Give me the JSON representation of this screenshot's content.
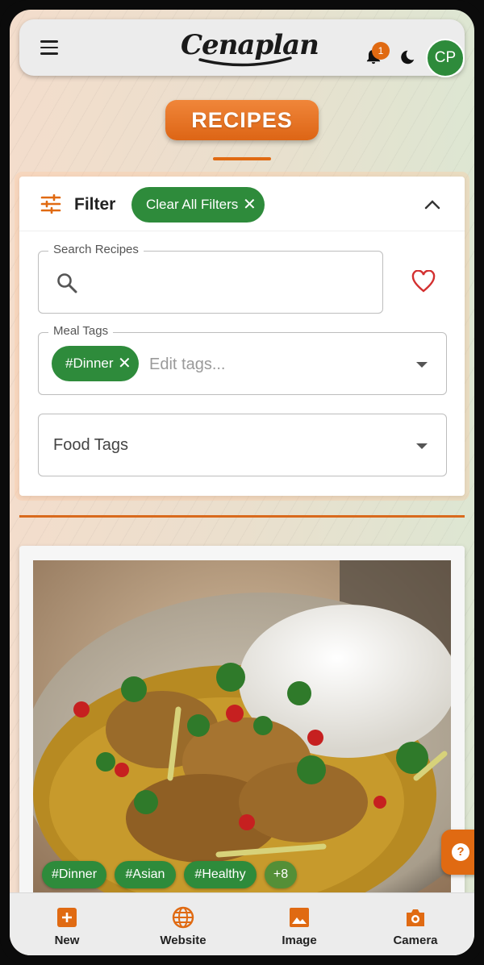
{
  "app": {
    "logo_text": "Cenaplan",
    "notification_count": "1",
    "avatar_initials": "CP"
  },
  "page": {
    "title": "RECIPES"
  },
  "filter": {
    "label": "Filter",
    "clear_all_label": "Clear All Filters",
    "search": {
      "label": "Search Recipes",
      "value": ""
    },
    "meal_tags": {
      "label": "Meal Tags",
      "selected": [
        "#Dinner"
      ],
      "placeholder": "Edit tags..."
    },
    "food_tags": {
      "label": "Food Tags"
    }
  },
  "recipe_card": {
    "tags": [
      "#Dinner",
      "#Asian",
      "#Healthy"
    ],
    "more_count": "+8"
  },
  "bottom_nav": {
    "items": [
      {
        "label": "New",
        "icon": "add-box-icon"
      },
      {
        "label": "Website",
        "icon": "globe-icon"
      },
      {
        "label": "Image",
        "icon": "image-icon"
      },
      {
        "label": "Camera",
        "icon": "camera-icon"
      }
    ]
  },
  "colors": {
    "accent_orange": "#e06a12",
    "chip_green": "#2e8b3b",
    "heart_red": "#d32f2f"
  }
}
